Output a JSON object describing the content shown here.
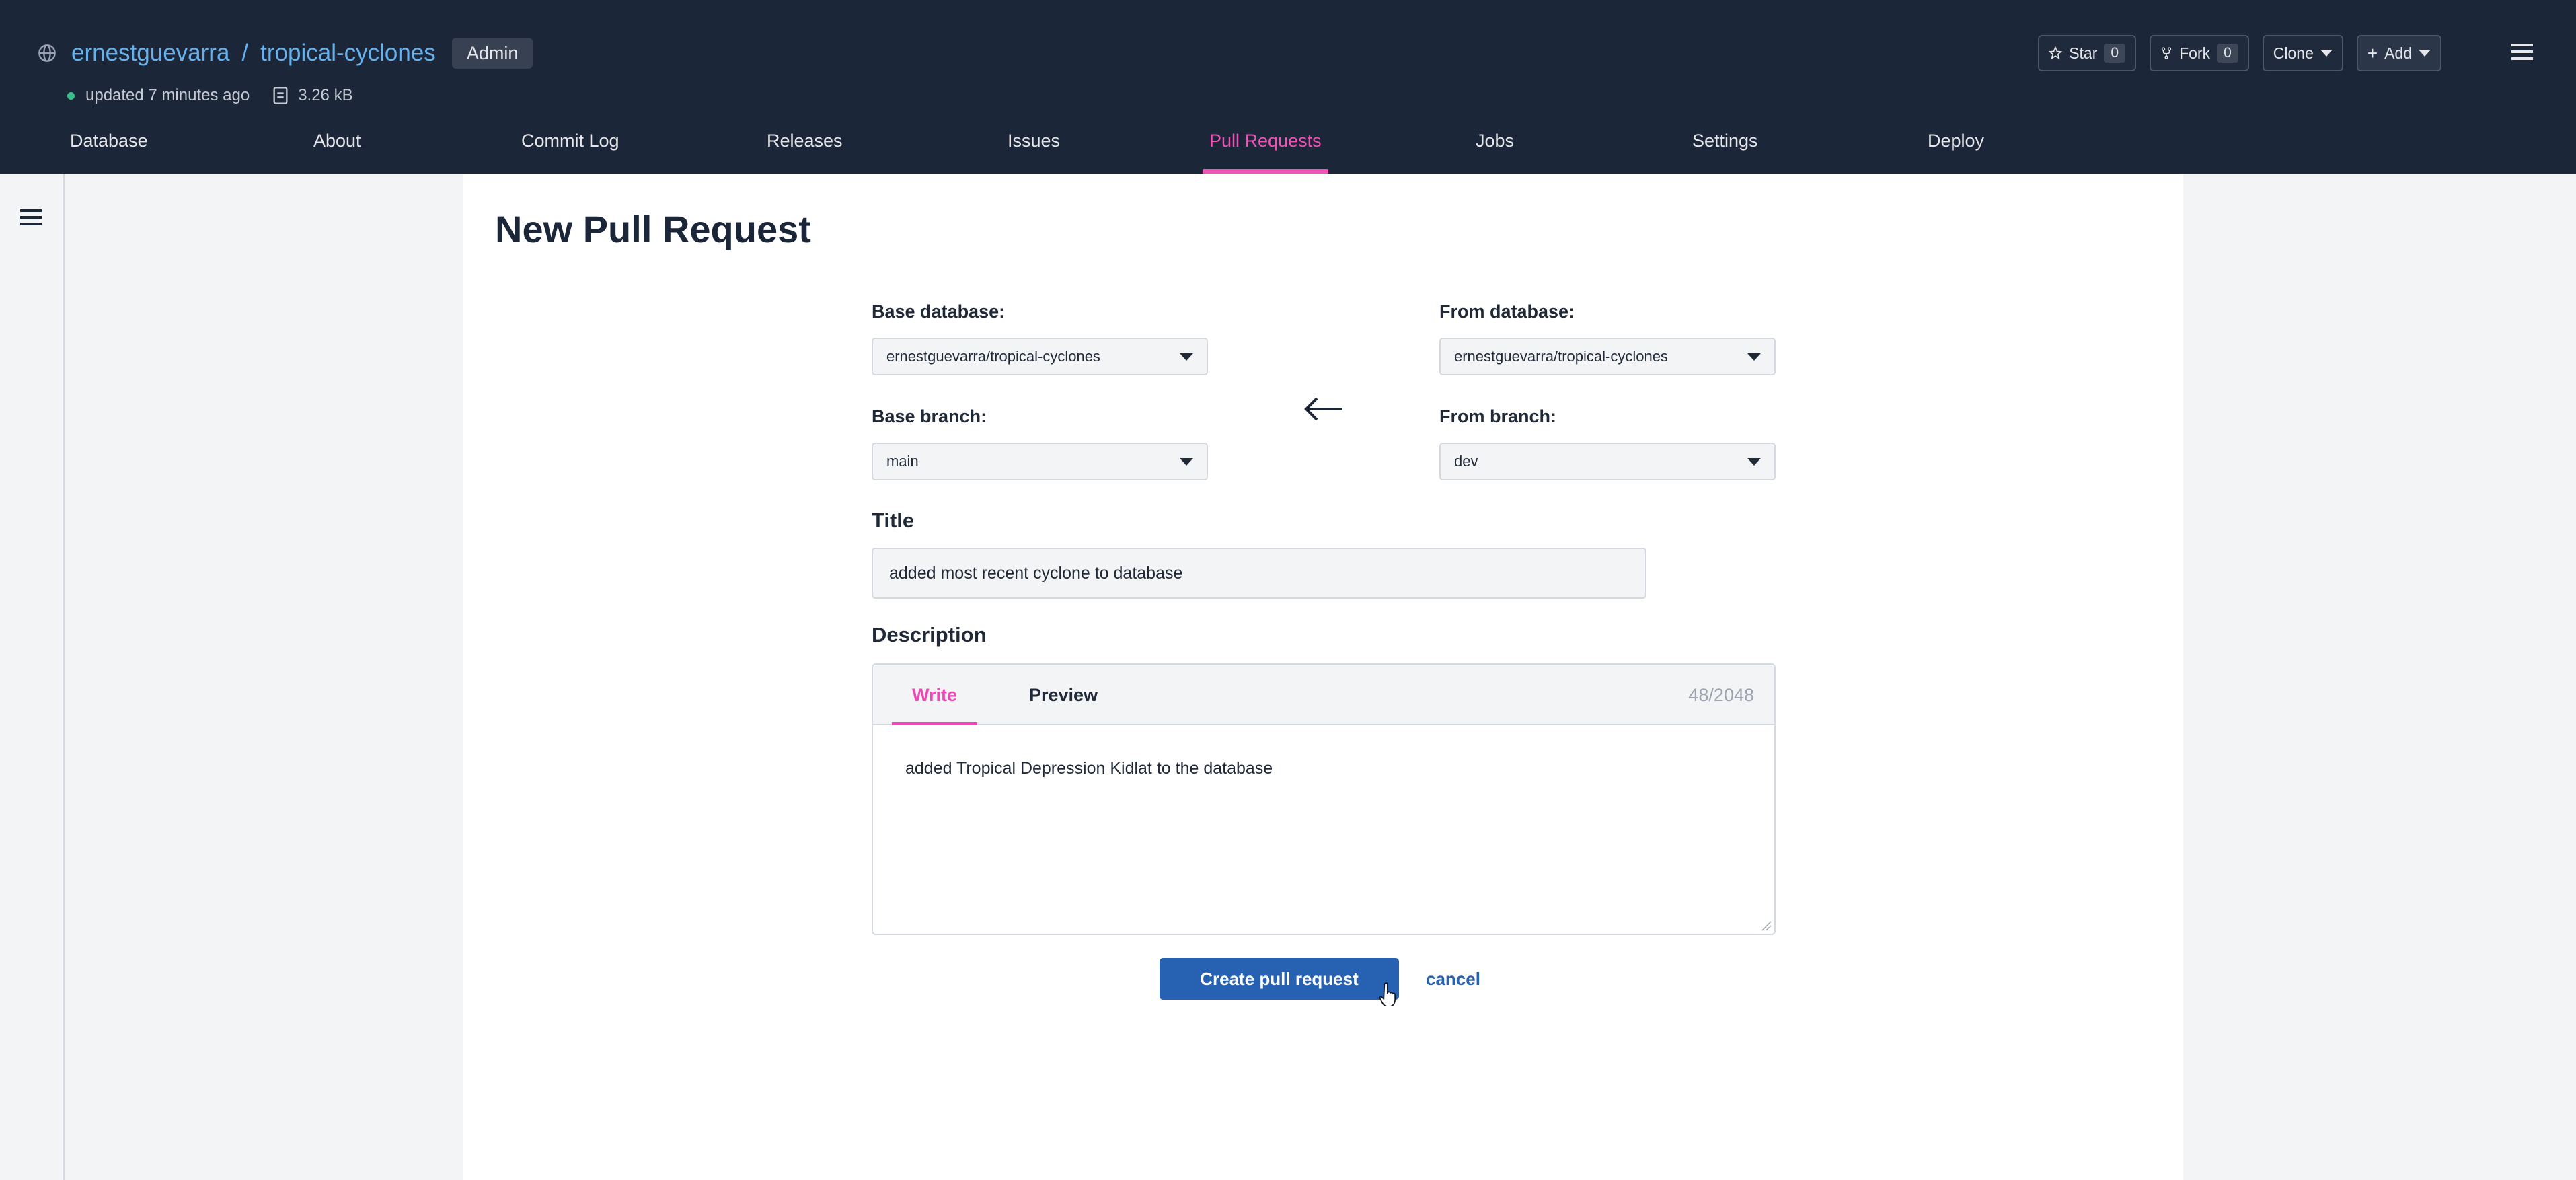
{
  "header": {
    "owner": "ernestguevarra",
    "separator": "/",
    "repo": "tropical-cyclones",
    "role_badge": "Admin",
    "updated": "updated 7 minutes ago",
    "size": "3.26 kB",
    "icons": {
      "globe": "globe-icon",
      "size": "file-size-icon",
      "menu": "hamburger-icon"
    },
    "actions": {
      "star_label": "Star",
      "star_count": "0",
      "fork_label": "Fork",
      "fork_count": "0",
      "clone_label": "Clone",
      "add_label": "Add"
    },
    "colors": {
      "background": "#1b2638",
      "link": "#66b2ef",
      "accent": "#f152b6"
    }
  },
  "nav": {
    "tabs": [
      {
        "label": "Database"
      },
      {
        "label": "About"
      },
      {
        "label": "Commit Log"
      },
      {
        "label": "Releases"
      },
      {
        "label": "Issues"
      },
      {
        "label": "Pull Requests",
        "active": true
      },
      {
        "label": "Jobs"
      },
      {
        "label": "Settings"
      },
      {
        "label": "Deploy"
      }
    ]
  },
  "page": {
    "title": "New Pull Request",
    "base_database_label": "Base database:",
    "base_database_value": "ernestguevarra/tropical-cyclones",
    "from_database_label": "From database:",
    "from_database_value": "ernestguevarra/tropical-cyclones",
    "base_branch_label": "Base branch:",
    "base_branch_value": "main",
    "from_branch_label": "From branch:",
    "from_branch_value": "dev",
    "title_label": "Title",
    "title_value": "added most recent cyclone to database",
    "description_label": "Description",
    "tab_write": "Write",
    "tab_preview": "Preview",
    "char_count": "48/2048",
    "description_value": "added Tropical Depression Kidlat to the database",
    "create_button": "Create pull request",
    "cancel_link": "cancel",
    "colors": {
      "primary_button": "#2762b2",
      "active_tab": "#ef47b3"
    }
  }
}
